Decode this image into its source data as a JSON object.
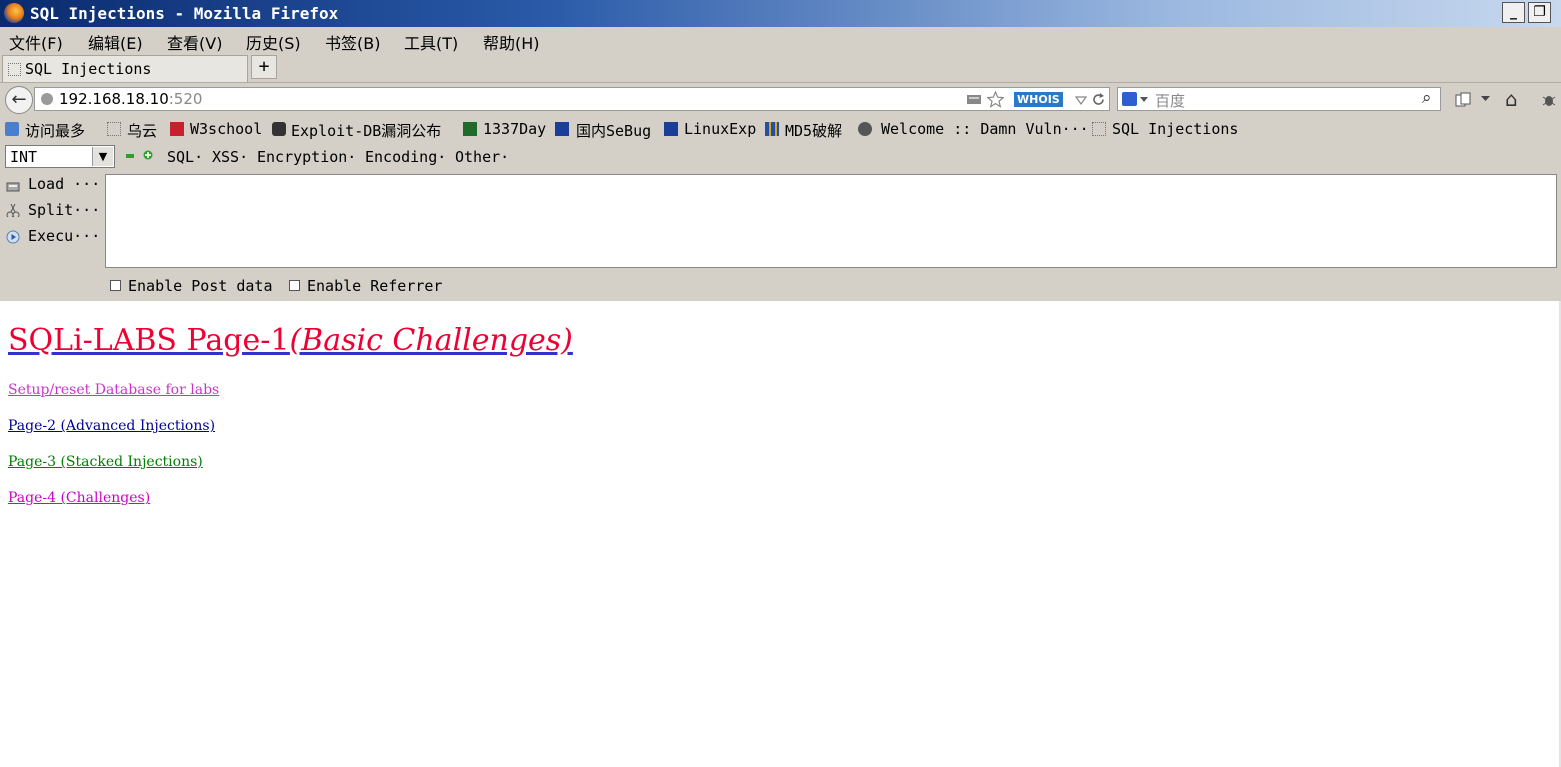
{
  "window": {
    "title": "SQL Injections - Mozilla Firefox",
    "minimize_glyph": "_",
    "restore_glyph": "❐"
  },
  "menu": {
    "items": [
      "文件(F)",
      "编辑(E)",
      "查看(V)",
      "历史(S)",
      "书签(B)",
      "工具(T)",
      "帮助(H)"
    ]
  },
  "tabs": {
    "active_label": "SQL Injections",
    "new_tab_glyph": "+"
  },
  "navbar": {
    "back_glyph": "←",
    "url_host": "192.168.18.10",
    "url_port": ":520",
    "whois_badge": "WHOIS",
    "search_placeholder": "百度",
    "search_glyph": "⌕",
    "home_glyph": "⌂"
  },
  "bookmarks": {
    "items": [
      "访问最多",
      "乌云",
      "W3school",
      "Exploit-DB漏洞公布",
      "1337Day",
      "国内SeBug",
      "LinuxExp",
      "MD5破解",
      "Welcome :: Damn Vuln···",
      "SQL Injections"
    ]
  },
  "hackbar": {
    "type_select_value": "INT",
    "menus": [
      "SQL·",
      "XSS·",
      "Encryption·",
      "Encoding·",
      "Other·"
    ],
    "load_label": "Load ···",
    "split_label": "Split···",
    "execute_label": "Execu···",
    "url_value": "",
    "enable_post_label": "Enable Post data",
    "enable_referrer_label": "Enable Referrer"
  },
  "page": {
    "title_main": "SQLi-LABS Page-1",
    "title_italic": "(Basic Challenges)",
    "links": [
      {
        "label": "Setup/reset Database for labs",
        "color": "#cc33cc"
      },
      {
        "label": "Page-2 (Advanced Injections)",
        "color": "#000099"
      },
      {
        "label": "Page-3 (Stacked Injections)",
        "color": "#008000"
      },
      {
        "label": "Page-4 (Challenges)",
        "color": "#cc00cc"
      }
    ]
  },
  "colors": {
    "title_red": "#ee0033",
    "chrome_gray": "#d4d0c8",
    "titlebar_blue": "#0a2a6e"
  }
}
